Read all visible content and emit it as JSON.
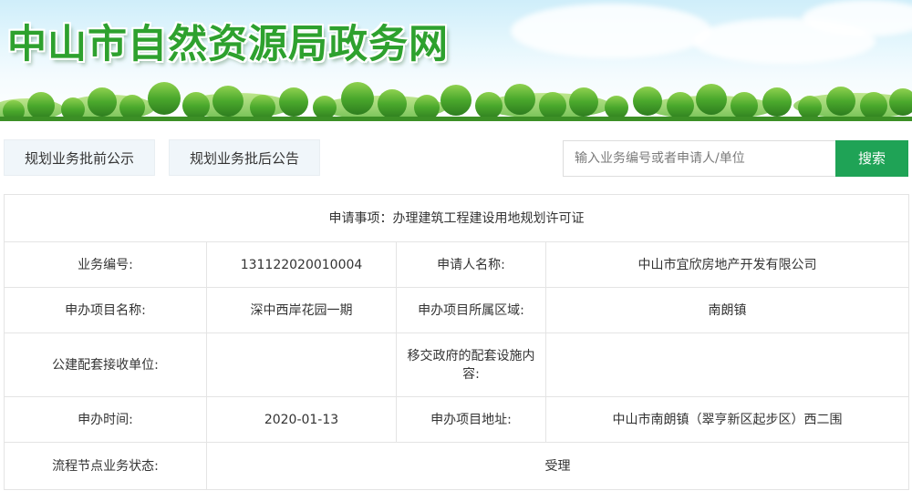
{
  "header": {
    "site_title": "中山市自然资源局政务网"
  },
  "toolbar": {
    "tab_pre_label": "规划业务批前公示",
    "tab_post_label": "规划业务批后公告",
    "search_placeholder": "输入业务编号或者申请人/单位",
    "search_button_label": "搜索"
  },
  "detail": {
    "title": "申请事项：办理建筑工程建设用地规划许可证",
    "rows": [
      {
        "label1": "业务编号:",
        "value1": "131122020010004",
        "label2": "申请人名称:",
        "value2": "中山市宜欣房地产开发有限公司"
      },
      {
        "label1": "申办项目名称:",
        "value1": "深中西岸花园一期",
        "label2": "申办项目所属区域:",
        "value2": "南朗镇"
      },
      {
        "label1": "公建配套接收单位:",
        "value1": "",
        "label2": "移交政府的配套设施内容:",
        "value2": ""
      },
      {
        "label1": "申办时间:",
        "value1": "2020-01-13",
        "label2": "申办项目地址:",
        "value2": "中山市南朗镇（翠亨新区起步区）西二围"
      }
    ],
    "status_label": "流程节点业务状态:",
    "status_value": "受理"
  },
  "colors": {
    "title_green": "#2ea12e",
    "search_button": "#1fa356",
    "tab_background": "#f0f6fa",
    "border": "#e4e4e4"
  },
  "icons": [
    "tree-line-graphic"
  ]
}
